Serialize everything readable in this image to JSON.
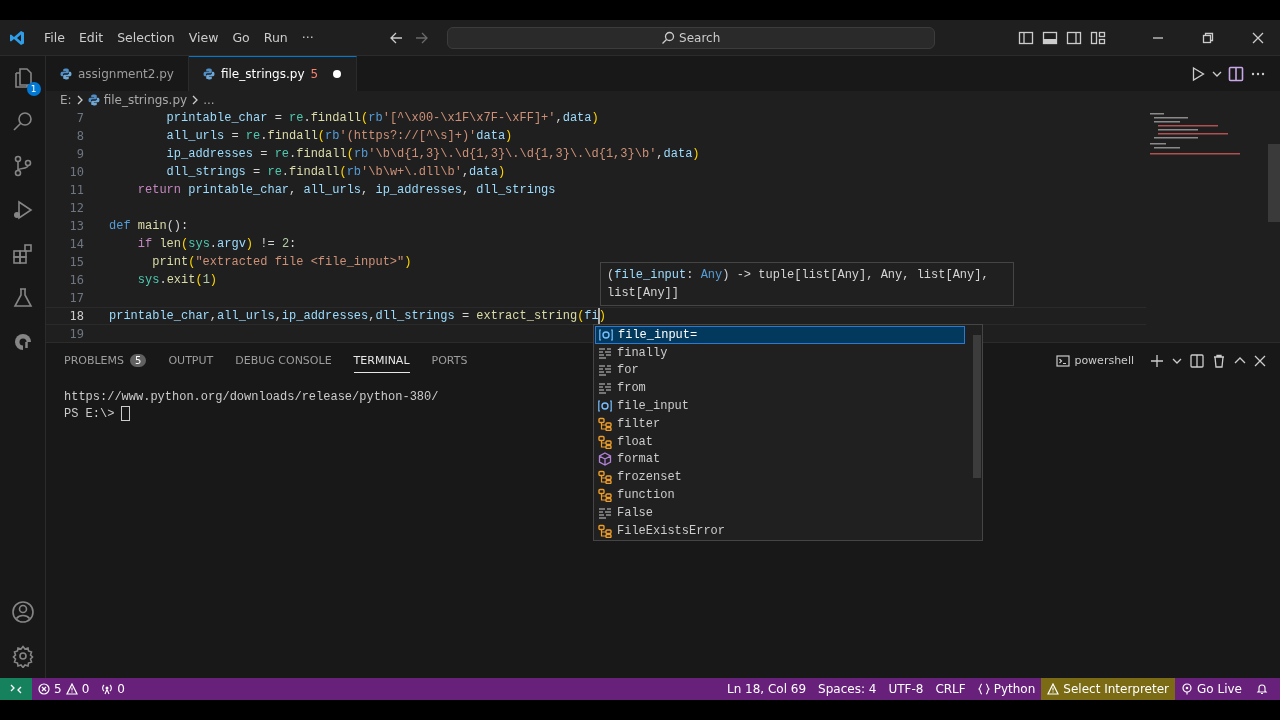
{
  "menu": [
    "File",
    "Edit",
    "Selection",
    "View",
    "Go",
    "Run",
    "···"
  ],
  "search": {
    "placeholder": "Search"
  },
  "activity_bar": {
    "explorer_badge": "1"
  },
  "tabs": [
    {
      "label": "assignment2.py",
      "selected": false,
      "modified": false
    },
    {
      "label": "file_strings.py",
      "selected": true,
      "problems": "5",
      "modified": true
    }
  ],
  "breadcrumbs": [
    "E:",
    "file_strings.py",
    "..."
  ],
  "code_lines": [
    {
      "number": "7",
      "current": false,
      "tokens": [
        {
          "text": "        printable_char",
          "kind": "var"
        },
        {
          "text": " = ",
          "kind": "pl"
        },
        {
          "text": "re",
          "kind": "cls"
        },
        {
          "text": ".",
          "kind": "pl"
        },
        {
          "text": "findall",
          "kind": "fn"
        },
        {
          "text": "(",
          "kind": "br"
        },
        {
          "text": "rb",
          "kind": "kw"
        },
        {
          "text": "'[^\\x00-\\x1F\\x7F-\\xFF]+'",
          "kind": "str"
        },
        {
          "text": ",",
          "kind": "pl"
        },
        {
          "text": "data",
          "kind": "var"
        },
        {
          "text": ")",
          "kind": "br"
        }
      ]
    },
    {
      "number": "8",
      "current": false,
      "tokens": [
        {
          "text": "        all_urls",
          "kind": "var"
        },
        {
          "text": " = ",
          "kind": "pl"
        },
        {
          "text": "re",
          "kind": "cls"
        },
        {
          "text": ".",
          "kind": "pl"
        },
        {
          "text": "findall",
          "kind": "fn"
        },
        {
          "text": "(",
          "kind": "br"
        },
        {
          "text": "rb",
          "kind": "kw"
        },
        {
          "text": "'(https?://[^\\s]+)'",
          "kind": "str"
        },
        {
          "text": "data",
          "kind": "var"
        },
        {
          "text": ")",
          "kind": "br"
        }
      ]
    },
    {
      "number": "9",
      "current": false,
      "tokens": [
        {
          "text": "        ip_addresses",
          "kind": "var"
        },
        {
          "text": " = ",
          "kind": "pl"
        },
        {
          "text": "re",
          "kind": "cls"
        },
        {
          "text": ".",
          "kind": "pl"
        },
        {
          "text": "findall",
          "kind": "fn"
        },
        {
          "text": "(",
          "kind": "br"
        },
        {
          "text": "rb",
          "kind": "kw"
        },
        {
          "text": "'\\b\\d{1,3}\\.\\d{1,3}\\.\\d{1,3}\\.\\d{1,3}\\b'",
          "kind": "str"
        },
        {
          "text": ",",
          "kind": "pl"
        },
        {
          "text": "data",
          "kind": "var"
        },
        {
          "text": ")",
          "kind": "br"
        }
      ]
    },
    {
      "number": "10",
      "current": false,
      "tokens": [
        {
          "text": "        dll_strings",
          "kind": "var"
        },
        {
          "text": " = ",
          "kind": "pl"
        },
        {
          "text": "re",
          "kind": "cls"
        },
        {
          "text": ".",
          "kind": "pl"
        },
        {
          "text": "findall",
          "kind": "fn"
        },
        {
          "text": "(",
          "kind": "br"
        },
        {
          "text": "rb",
          "kind": "kw"
        },
        {
          "text": "'\\b\\w+\\.dll\\b'",
          "kind": "str"
        },
        {
          "text": ",",
          "kind": "pl"
        },
        {
          "text": "data",
          "kind": "var"
        },
        {
          "text": ")",
          "kind": "br"
        }
      ]
    },
    {
      "number": "11",
      "current": false,
      "tokens": [
        {
          "text": "    return",
          "kind": "ctl"
        },
        {
          "text": " printable_char",
          "kind": "var"
        },
        {
          "text": ", ",
          "kind": "pl"
        },
        {
          "text": "all_urls",
          "kind": "var"
        },
        {
          "text": ", ",
          "kind": "pl"
        },
        {
          "text": "ip_addresses",
          "kind": "var"
        },
        {
          "text": ", ",
          "kind": "pl"
        },
        {
          "text": "dll_strings",
          "kind": "var"
        }
      ]
    },
    {
      "number": "12",
      "current": false
    },
    {
      "number": "13",
      "current": false,
      "tokens": [
        {
          "text": "def",
          "kind": "kw"
        },
        {
          "text": " main",
          "kind": "fn"
        },
        {
          "text": "():",
          "kind": "pl"
        }
      ]
    },
    {
      "number": "14",
      "current": false,
      "tokens": [
        {
          "text": "    if",
          "kind": "ctl"
        },
        {
          "text": " len",
          "kind": "fn"
        },
        {
          "text": "(",
          "kind": "br"
        },
        {
          "text": "sys",
          "kind": "cls"
        },
        {
          "text": ".",
          "kind": "pl"
        },
        {
          "text": "argv",
          "kind": "var"
        },
        {
          "text": ")",
          "kind": "br"
        },
        {
          "text": " != ",
          "kind": "pl"
        },
        {
          "text": "2",
          "kind": "num"
        },
        {
          "text": ":",
          "kind": "pl"
        }
      ]
    },
    {
      "number": "15",
      "current": false,
      "tokens": [
        {
          "text": "      print",
          "kind": "fn"
        },
        {
          "text": "(",
          "kind": "br"
        },
        {
          "text": "\"extracted file <file_input>\"",
          "kind": "str"
        },
        {
          "text": ")",
          "kind": "br"
        }
      ]
    },
    {
      "number": "16",
      "current": false,
      "tokens": [
        {
          "text": "    sys",
          "kind": "cls"
        },
        {
          "text": ".",
          "kind": "pl"
        },
        {
          "text": "exit",
          "kind": "fn"
        },
        {
          "text": "(",
          "kind": "br"
        },
        {
          "text": "1",
          "kind": "num"
        },
        {
          "text": ")",
          "kind": "br"
        }
      ]
    },
    {
      "number": "17",
      "current": false
    },
    {
      "number": "18",
      "current": true,
      "tokens": [
        {
          "text": "printable_char",
          "kind": "var"
        },
        {
          "text": ",",
          "kind": "pl"
        },
        {
          "text": "all_urls",
          "kind": "var"
        },
        {
          "text": ",",
          "kind": "pl"
        },
        {
          "text": "ip_addresses",
          "kind": "var"
        },
        {
          "text": ",",
          "kind": "pl"
        },
        {
          "text": "dll_strings",
          "kind": "var"
        },
        {
          "text": " = ",
          "kind": "pl"
        },
        {
          "text": "extract_string",
          "kind": "fn"
        },
        {
          "text": "(",
          "kind": "br"
        },
        {
          "text": "fi",
          "kind": "var"
        },
        {
          "text": ")",
          "kind": "br"
        }
      ]
    },
    {
      "number": "19",
      "current": false
    }
  ],
  "hover": {
    "tokens": [
      {
        "text": "(",
        "kind": "pl"
      },
      {
        "text": "file_input",
        "kind": "var"
      },
      {
        "text": ": ",
        "kind": "pl"
      },
      {
        "text": "Any",
        "kind": "kw"
      },
      {
        "text": ") -> tuple[list[Any], Any, list[Any], list[Any]]",
        "kind": "pl"
      }
    ]
  },
  "suggestions": [
    {
      "label": "file_input=",
      "kind": "variable",
      "selected": true
    },
    {
      "label": "finally",
      "kind": "keyword",
      "selected": false
    },
    {
      "label": "for",
      "kind": "keyword",
      "selected": false
    },
    {
      "label": "from",
      "kind": "keyword",
      "selected": false
    },
    {
      "label": "file_input",
      "kind": "variable",
      "selected": false
    },
    {
      "label": "filter",
      "kind": "class",
      "selected": false
    },
    {
      "label": "float",
      "kind": "class",
      "selected": false
    },
    {
      "label": "format",
      "kind": "method",
      "selected": false
    },
    {
      "label": "frozenset",
      "kind": "class",
      "selected": false
    },
    {
      "label": "function",
      "kind": "class",
      "selected": false
    },
    {
      "label": "False",
      "kind": "keyword",
      "selected": false
    },
    {
      "label": "FileExistsError",
      "kind": "class",
      "selected": false
    }
  ],
  "panel_tabs": [
    {
      "label": "PROBLEMS",
      "badge": "5",
      "selected": false
    },
    {
      "label": "OUTPUT",
      "selected": false
    },
    {
      "label": "DEBUG CONSOLE",
      "selected": false
    },
    {
      "label": "TERMINAL",
      "selected": true
    },
    {
      "label": "PORTS",
      "selected": false
    }
  ],
  "terminal": {
    "shell": "powershell",
    "lines": [
      "https://www.python.org/downloads/release/python-380/",
      "PS E:\\>"
    ]
  },
  "status_bar": {
    "errors": "5",
    "warnings": "0",
    "ports": "0",
    "position": "Ln 18, Col 69",
    "spaces": "Spaces: 4",
    "encoding": "UTF-8",
    "eol": "CRLF",
    "language": "Python",
    "interpreter": "Select Interpreter",
    "live": "Go Live"
  }
}
